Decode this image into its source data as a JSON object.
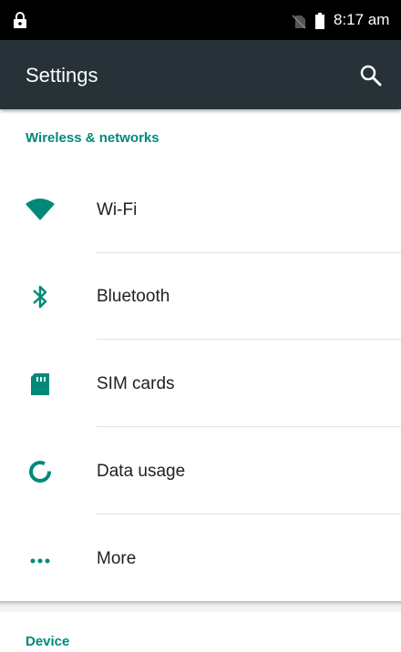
{
  "status_bar": {
    "time": "8:17 am"
  },
  "app_bar": {
    "title": "Settings"
  },
  "sections": [
    {
      "header": "Wireless & networks"
    },
    {
      "header": "Device"
    }
  ],
  "items": [
    {
      "label": "Wi-Fi",
      "icon": "wifi-icon"
    },
    {
      "label": "Bluetooth",
      "icon": "bluetooth-icon"
    },
    {
      "label": "SIM cards",
      "icon": "sim-card-icon"
    },
    {
      "label": "Data usage",
      "icon": "data-usage-icon"
    },
    {
      "label": "More",
      "icon": "more-icon"
    }
  ],
  "colors": {
    "accent": "#00897b",
    "app_bar": "#263238",
    "status_bar": "#000000"
  }
}
